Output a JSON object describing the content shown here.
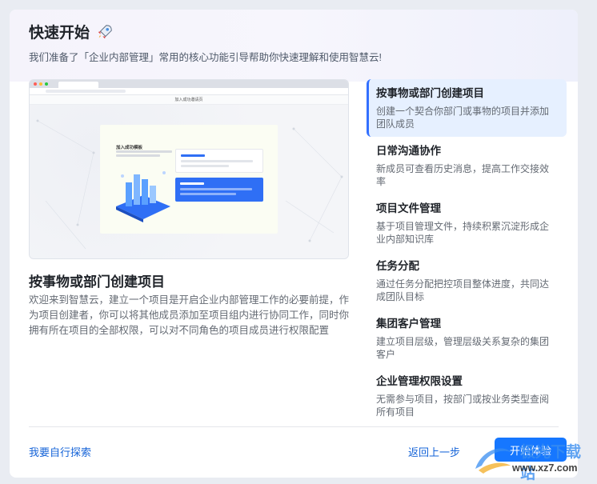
{
  "header": {
    "title": "快速开始",
    "subtitle": "我们准备了「企业内部管理」常用的核心功能引导帮助你快速理解和使用智慧云!"
  },
  "preview": {
    "browser_title": "加入成功邀请页",
    "card_title": "加入成功模板"
  },
  "content": {
    "heading": "按事物或部门创建项目",
    "description": "欢迎来到智慧云，建立一个项目是开启企业内部管理工作的必要前提，作为项目创建者，你可以将其他成员添加至项目组内进行协同工作，同时你拥有所在项目的全部权限，可以对不同角色的项目成员进行权限配置"
  },
  "steps": [
    {
      "title": "按事物或部门创建项目",
      "desc": "创建一个契合你部门或事物的项目并添加团队成员",
      "active": true
    },
    {
      "title": "日常沟通协作",
      "desc": "新成员可查看历史消息，提高工作交接效率",
      "active": false
    },
    {
      "title": "项目文件管理",
      "desc": "基于项目管理文件，持续积累沉淀形成企业内部知识库",
      "active": false
    },
    {
      "title": "任务分配",
      "desc": "通过任务分配把控项目整体进度，共同达成团队目标",
      "active": false
    },
    {
      "title": "集团客户管理",
      "desc": "建立项目层级，管理层级关系复杂的集团客户",
      "active": false
    },
    {
      "title": "企业管理权限设置",
      "desc": "无需参与项目，按部门或按业务类型查阅所有项目",
      "active": false
    }
  ],
  "footer": {
    "explore_label": "我要自行探索",
    "back_label": "返回上一步",
    "start_label": "开始体验"
  },
  "watermark": {
    "line1": "极光下载站",
    "line2": "www.xz7.com"
  },
  "colors": {
    "accent": "#1677ff",
    "link": "#1664d8",
    "active_bg": "#e6f0ff"
  }
}
